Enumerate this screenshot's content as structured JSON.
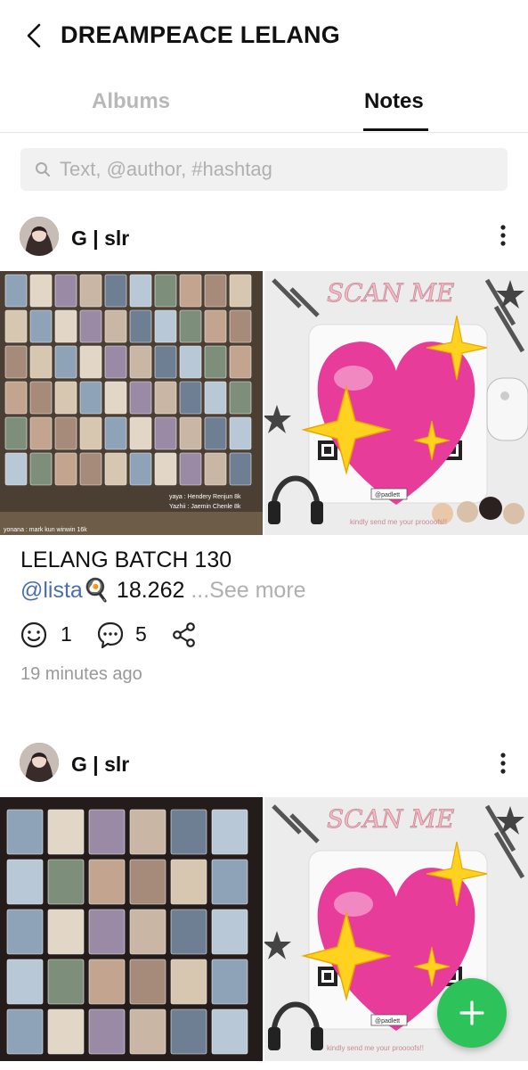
{
  "header": {
    "title": "DREAMPEACE LELANG"
  },
  "tabs": [
    {
      "label": "Albums",
      "active": false
    },
    {
      "label": "Notes",
      "active": true
    }
  ],
  "search": {
    "placeholder": "Text, @author, #hashtag"
  },
  "posts": [
    {
      "author": "G | slr",
      "title": "LELANG BATCH 130",
      "mention": "@lista",
      "mention_emoji": "🍳",
      "body_text": " 18.262 ",
      "see_more": "...See more",
      "reactions": "1",
      "comments": "5",
      "time": "19 minutes ago",
      "left_photo_captions": [
        "yaya : Hendery Renjun 8k",
        "Yazhii : Jaemin Chenle 8k",
        "yonana : mark kun winwin 16k"
      ],
      "right_photo_caption": "kindly send me your proooofs!!",
      "qr_tag": "@padlett"
    },
    {
      "author": "G | slr",
      "right_photo_caption": "kindly send me your proooofs!!",
      "qr_tag": "@padlett"
    }
  ],
  "colors": {
    "accent_green": "#2ec25a",
    "mention_blue": "#4a6fa8",
    "heart_pink": "#e83c9a",
    "sparkle_yellow": "#ffd21f"
  },
  "icons": {
    "back": "chevron-left-icon",
    "search": "search-icon",
    "more": "more-vertical-icon",
    "smile": "smile-icon",
    "comment": "comment-icon",
    "share": "share-icon",
    "add": "plus-icon"
  }
}
